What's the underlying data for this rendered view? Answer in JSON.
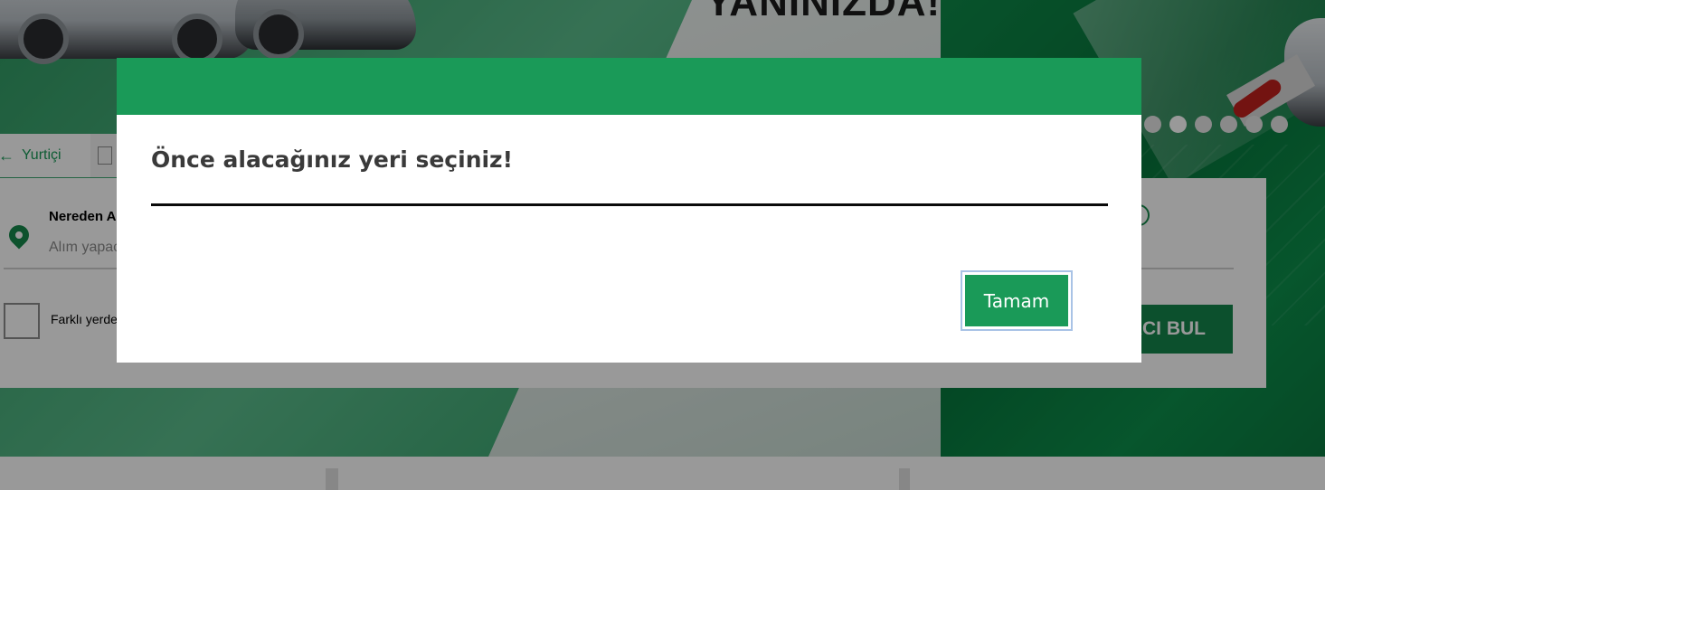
{
  "background": {
    "headline": "YANINIZDA!",
    "slider_dots": 6,
    "slider_active_index": 1,
    "tabs": [
      {
        "label": "Yurtiçi",
        "icon": "arrow-left-icon"
      },
      {
        "label": "",
        "icon": "document-icon"
      }
    ],
    "pickup_field": {
      "label": "Nereden A",
      "placeholder": "Alım yapac"
    },
    "different_dropoff_label": "Farklı yerde",
    "find_button_label": "ACI BUL",
    "info_icon": "info-icon"
  },
  "modal": {
    "title": "Önce alacağınız yeri seçiniz!",
    "ok_label": "Tamam",
    "header_color": "#1a9a58"
  },
  "colors": {
    "brand_green": "#1a9a58",
    "dark_green": "#14854b",
    "overlay": "rgba(0,0,0,0.4)"
  }
}
